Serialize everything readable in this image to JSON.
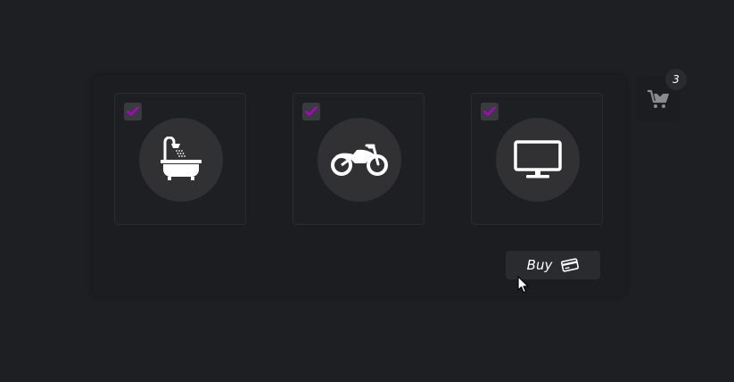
{
  "products": [
    {
      "icon": "bathtub-icon",
      "selected": true
    },
    {
      "icon": "motorcycle-icon",
      "selected": true
    },
    {
      "icon": "monitor-icon",
      "selected": true
    }
  ],
  "buy_button": {
    "label": "Buy",
    "icon": "credit-card-icon"
  },
  "cart": {
    "icon": "cart-download-icon",
    "count": "3"
  },
  "colors": {
    "background": "#1e1f22",
    "check_accent": "#b000c8",
    "circle": "#313134"
  }
}
